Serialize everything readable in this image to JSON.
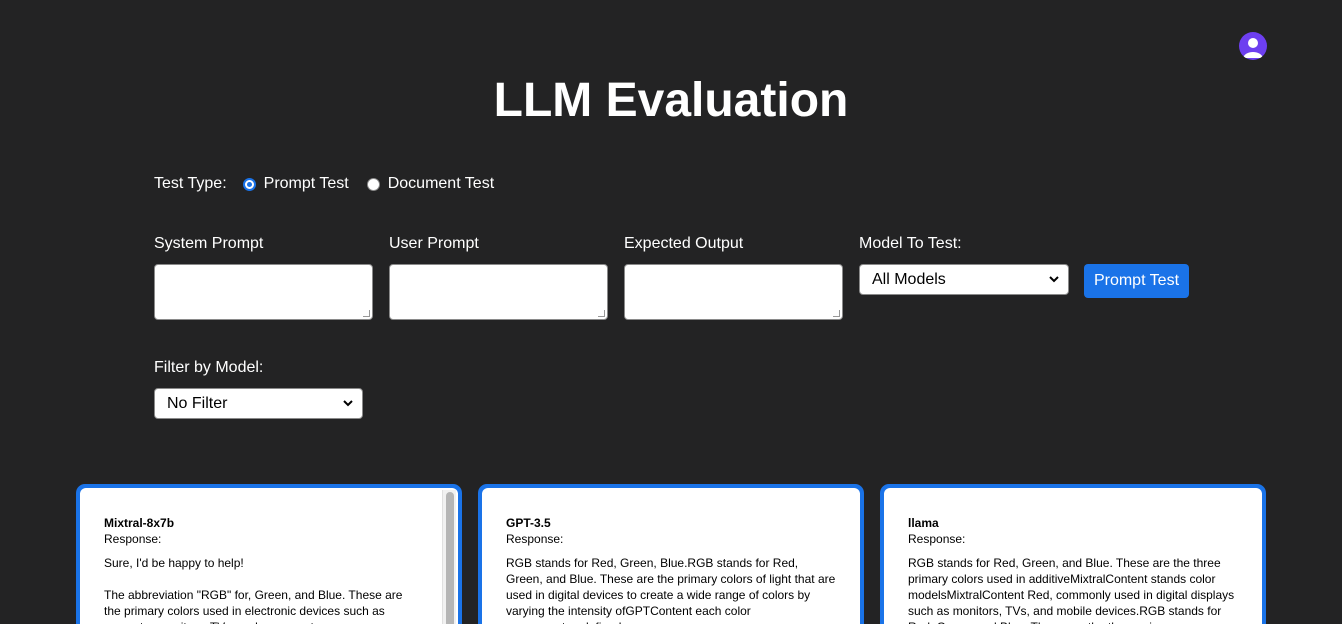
{
  "header": {
    "title": "LLM Evaluation",
    "avatar_icon": "user-avatar-icon"
  },
  "test_type": {
    "label": "Test Type:",
    "options": [
      {
        "label": "Prompt Test",
        "checked": true
      },
      {
        "label": "Document Test",
        "checked": false
      }
    ]
  },
  "form": {
    "system_prompt_label": "System Prompt",
    "user_prompt_label": "User Prompt",
    "expected_output_label": "Expected Output",
    "system_prompt_value": "",
    "user_prompt_value": "",
    "expected_output_value": "",
    "model_label": "Model To Test:",
    "model_selected": "All Models",
    "submit_label": "Prompt Test"
  },
  "filter": {
    "label": "Filter by Model:",
    "selected": "No Filter"
  },
  "results": [
    {
      "model": "Mixtral-8x7b",
      "response_label": "Response:",
      "text": "Sure, I'd be happy to help!\n\nThe abbreviation \"RGB\" for, Green, and Blue. These are the primary colors used in electronic devices such as computer monitors, TVs, and cameras to"
    },
    {
      "model": "GPT-3.5",
      "response_label": "Response:",
      "text": "RGB stands for Red, Green, Blue.RGB stands for Red, Green, and Blue. These are the primary colors of light that are used in digital devices to create a wide range of colors by varying the intensity ofGPTContent each color\ncomponent.undefined"
    },
    {
      "model": "llama",
      "response_label": "Response:",
      "text": "RGB stands for Red, Green, and Blue. These are the three primary colors used in additiveMixtralContent stands color modelsMixtralContent Red, commonly used in digital displays such as monitors, TVs, and mobile devices.RGB stands for Red, Green, and Blue. These are the three primary"
    }
  ],
  "colors": {
    "background": "#232324",
    "accent": "#1a73e8",
    "avatar": "#6d3ff0"
  }
}
